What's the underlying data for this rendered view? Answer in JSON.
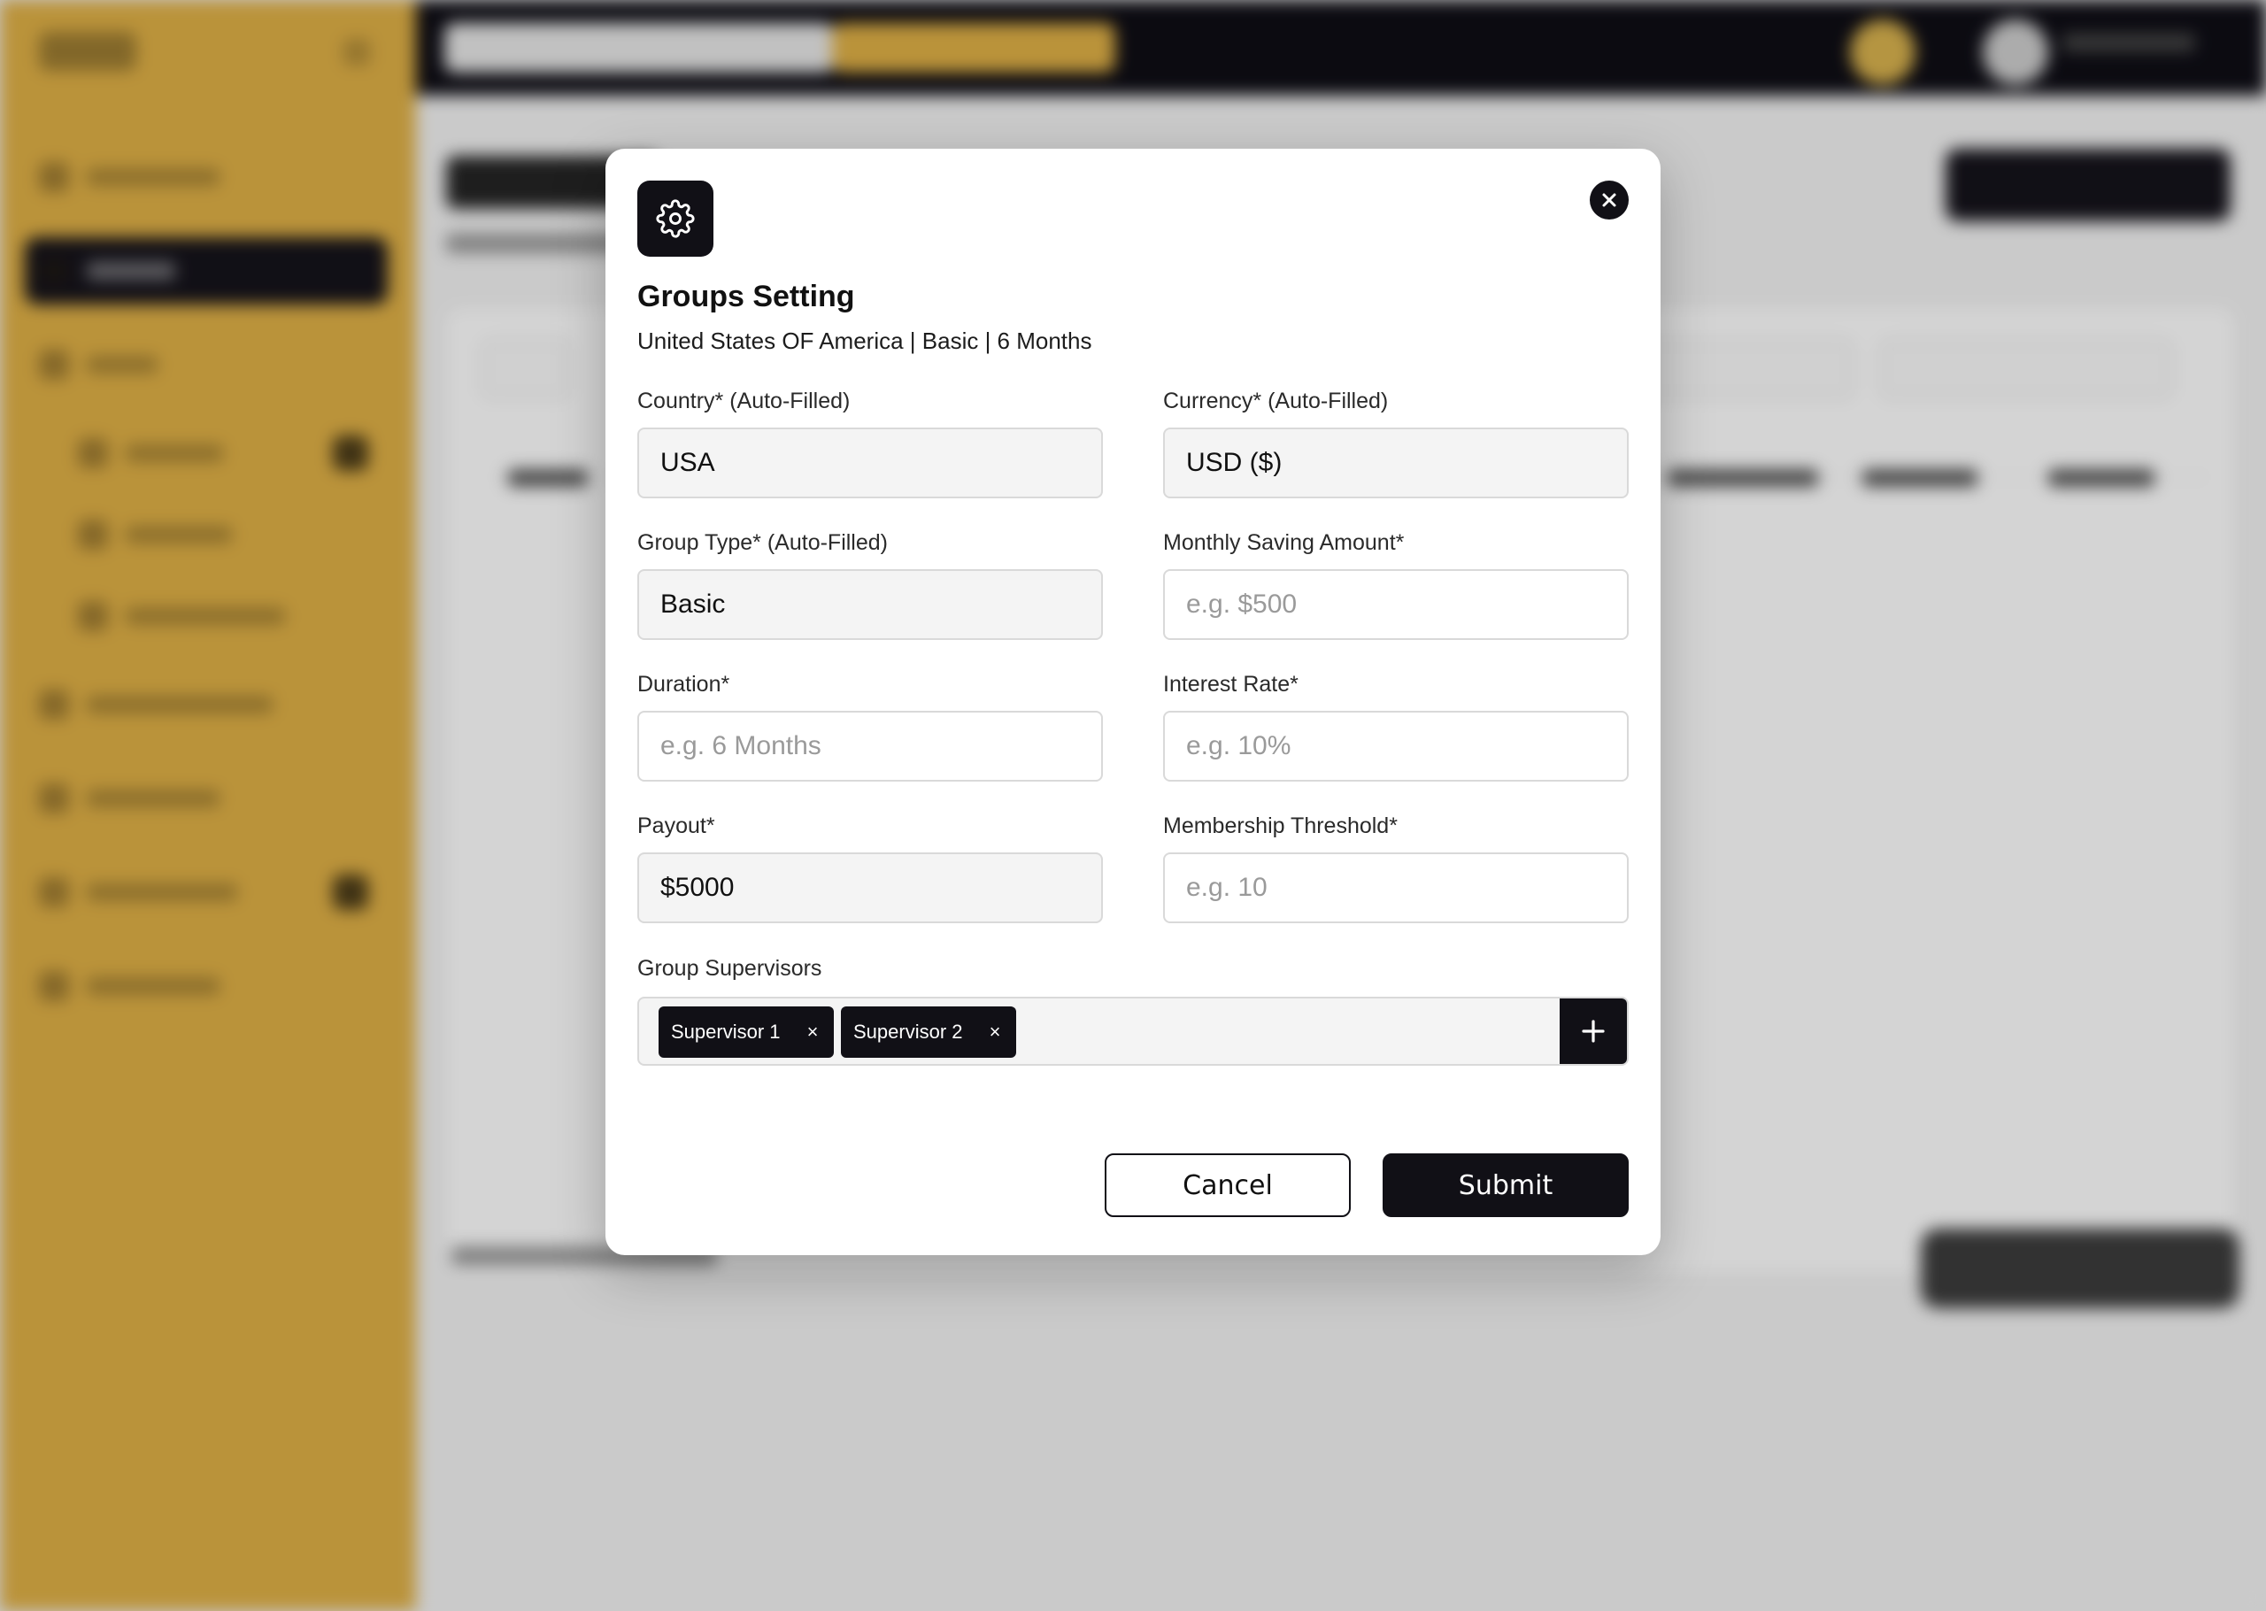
{
  "modal": {
    "title": "Groups Setting",
    "subtitle": "United States OF America | Basic | 6 Months",
    "icon": "gear-icon",
    "close_icon": "close-icon",
    "fields": {
      "country": {
        "label": "Country* (Auto-Filled)",
        "value": "USA",
        "placeholder": ""
      },
      "currency": {
        "label": "Currency* (Auto-Filled)",
        "value": "USD ($)",
        "placeholder": ""
      },
      "group_type": {
        "label": "Group Type* (Auto-Filled)",
        "value": "Basic",
        "placeholder": ""
      },
      "monthly_saving": {
        "label": "Monthly Saving Amount*",
        "value": "",
        "placeholder": "e.g. $500"
      },
      "duration": {
        "label": "Duration*",
        "value": "",
        "placeholder": "e.g. 6 Months"
      },
      "interest_rate": {
        "label": "Interest Rate*",
        "value": "",
        "placeholder": "e.g. 10%"
      },
      "payout": {
        "label": "Payout*",
        "value": "$5000",
        "placeholder": ""
      },
      "membership_threshold": {
        "label": "Membership Threshold*",
        "value": "",
        "placeholder": "e.g. 10"
      }
    },
    "supervisors": {
      "label": "Group Supervisors",
      "chips": [
        "Supervisor 1",
        "Supervisor 2"
      ],
      "remove_symbol": "×",
      "add_icon": "plus-icon"
    },
    "buttons": {
      "cancel": "Cancel",
      "submit": "Submit"
    }
  },
  "colors": {
    "sidebar": "#e0b044",
    "dark": "#111016",
    "readonly_field": "#f4f4f4",
    "placeholder": "#9a9a9a"
  }
}
